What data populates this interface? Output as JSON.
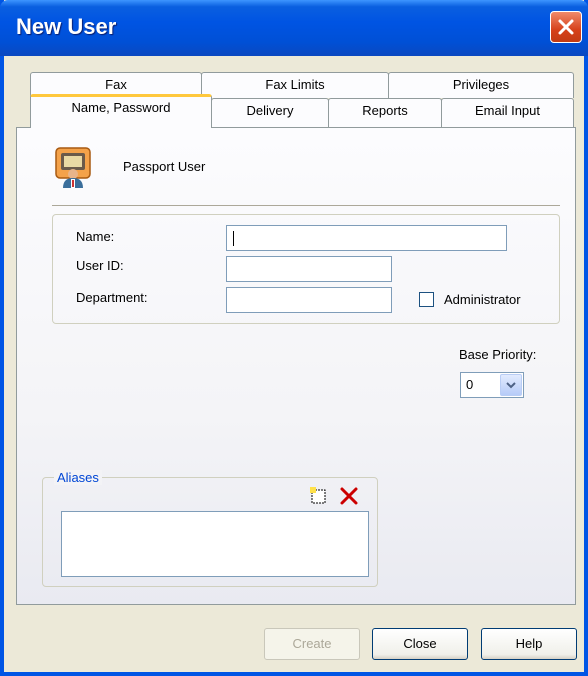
{
  "window": {
    "title": "New User"
  },
  "tabs": {
    "row_back": [
      "Fax",
      "Fax Limits",
      "Privileges"
    ],
    "row_front": [
      "Name, Password",
      "Delivery",
      "Reports",
      "Email Input"
    ],
    "active": "Name, Password"
  },
  "header": {
    "user_type": "Passport User",
    "icon": "passport-user-icon"
  },
  "form": {
    "name_label": "Name:",
    "name_value": "",
    "userid_label": "User ID:",
    "userid_value": "",
    "department_label": "Department:",
    "department_value": "",
    "administrator_label": "Administrator",
    "administrator_checked": false,
    "base_priority_label": "Base Priority:",
    "base_priority_value": "0"
  },
  "aliases": {
    "legend": "Aliases",
    "items": []
  },
  "buttons": {
    "create": "Create",
    "close": "Close",
    "help": "Help"
  },
  "colors": {
    "title_bar": "#0054e3",
    "active_tab_accent": "#ffc83c",
    "delete_icon": "#cc0000",
    "legend": "#0046d5"
  }
}
